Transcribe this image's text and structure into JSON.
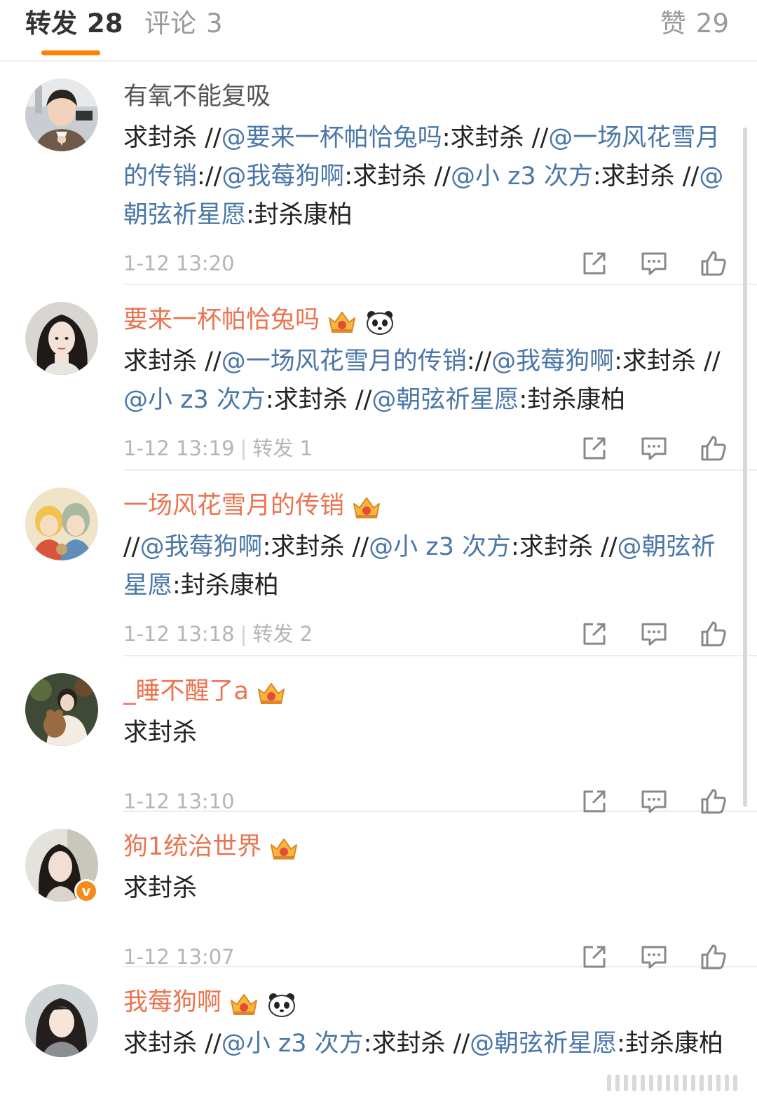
{
  "tabs": {
    "forward": {
      "label": "转发",
      "count": "28"
    },
    "comment": {
      "label": "评论",
      "count": "3"
    },
    "like": {
      "label": "赞",
      "count": "29"
    }
  },
  "colors": {
    "accent": "#ff8200",
    "vip_name": "#eb7350",
    "mention": "#4a76a8",
    "meta": "#b5b5b5"
  },
  "icons": {
    "share": "share-icon",
    "comment": "comment-icon",
    "like": "like-icon",
    "crown": "crown-badge-icon",
    "panda": "panda-badge-icon",
    "verified": "verified-badge-icon"
  },
  "items": [
    {
      "name": "有氧不能复吸",
      "content": [
        {
          "t": "求封杀 //",
          "m": false
        },
        {
          "t": "@要来一杯帕恰兔吗",
          "m": true
        },
        {
          "t": ":求封杀 //",
          "m": false
        },
        {
          "t": "@一场风花雪月的传销",
          "m": true
        },
        {
          "t": "://",
          "m": false
        },
        {
          "t": "@我莓狗啊",
          "m": true
        },
        {
          "t": ":求封杀 //",
          "m": false
        },
        {
          "t": "@小 z3 次方",
          "m": true
        },
        {
          "t": ":求封杀 //",
          "m": false
        },
        {
          "t": "@朝弦祈星愿",
          "m": true
        },
        {
          "t": ":封杀康柏",
          "m": false
        }
      ],
      "time": "1-12 13:20",
      "forward_text": ""
    },
    {
      "name": "要来一杯帕恰兔吗",
      "content": [
        {
          "t": "求封杀 //",
          "m": false
        },
        {
          "t": "@一场风花雪月的传销",
          "m": true
        },
        {
          "t": "://",
          "m": false
        },
        {
          "t": "@我莓狗啊",
          "m": true
        },
        {
          "t": ":求封杀 //",
          "m": false
        },
        {
          "t": "@小 z3 次方",
          "m": true
        },
        {
          "t": ":求封杀 //",
          "m": false
        },
        {
          "t": "@朝弦祈星愿",
          "m": true
        },
        {
          "t": ":封杀康柏",
          "m": false
        }
      ],
      "time": "1-12 13:19",
      "forward_text": "转发 1"
    },
    {
      "name": "一场风花雪月的传销",
      "content": [
        {
          "t": "//",
          "m": false
        },
        {
          "t": "@我莓狗啊",
          "m": true
        },
        {
          "t": ":求封杀 //",
          "m": false
        },
        {
          "t": "@小 z3 次方",
          "m": true
        },
        {
          "t": ":求封杀 //",
          "m": false
        },
        {
          "t": "@朝弦祈星愿",
          "m": true
        },
        {
          "t": ":封杀康柏",
          "m": false
        }
      ],
      "time": "1-12 13:18",
      "forward_text": "转发 2"
    },
    {
      "name": "_睡不醒了a",
      "content": [
        {
          "t": "求封杀",
          "m": false
        }
      ],
      "time": "1-12 13:10",
      "forward_text": ""
    },
    {
      "name": "狗1统治世界",
      "content": [
        {
          "t": "求封杀",
          "m": false
        }
      ],
      "time": "1-12 13:07",
      "forward_text": ""
    },
    {
      "name": "我莓狗啊",
      "content": [
        {
          "t": "求封杀 //",
          "m": false
        },
        {
          "t": "@小 z3 次方",
          "m": true
        },
        {
          "t": ":求封杀 //",
          "m": false
        },
        {
          "t": "@朝弦祈星愿",
          "m": true
        },
        {
          "t": ":封杀康柏",
          "m": false
        }
      ],
      "time": "",
      "forward_text": ""
    }
  ]
}
